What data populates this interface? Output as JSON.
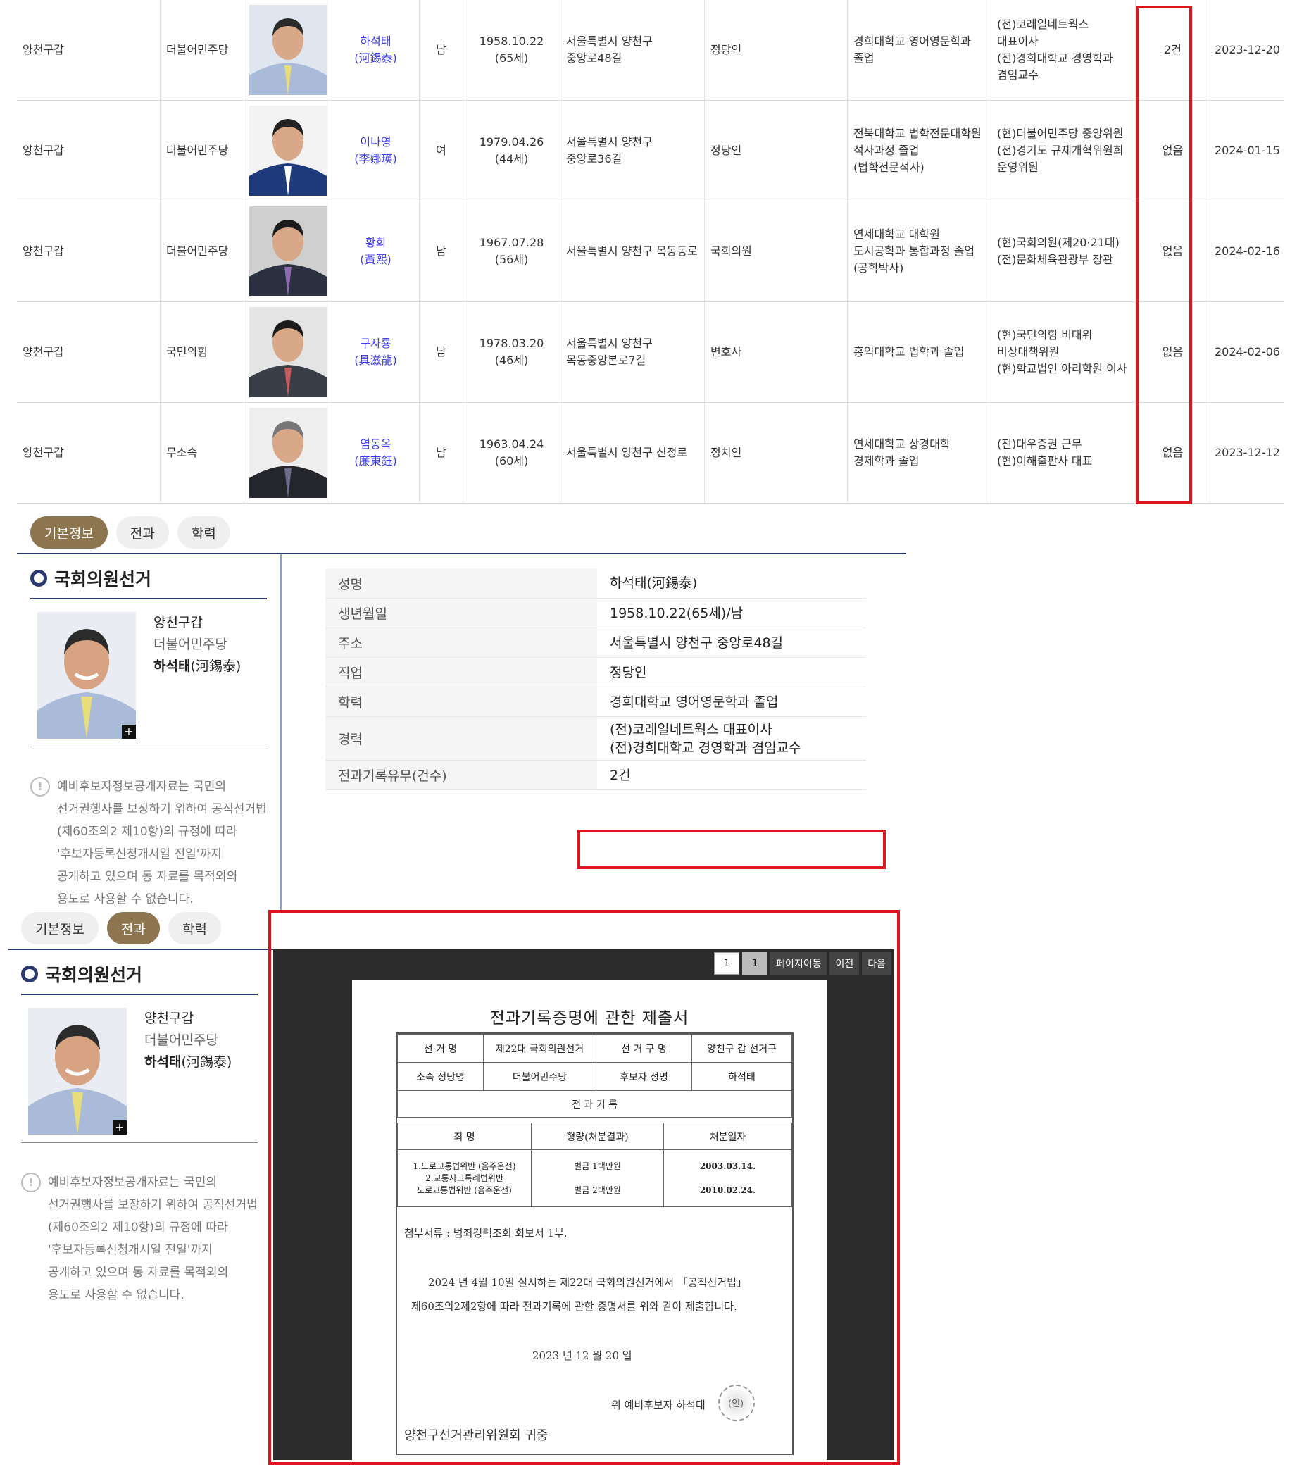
{
  "candidates": [
    {
      "district": "양천구갑",
      "party": "더불어민주당",
      "name": "하석태",
      "hanja": "(河錫泰)",
      "gender": "남",
      "birth": "1958.10.22",
      "age": "(65세)",
      "address": "서울특별시 양천구\n중앙로48길",
      "job": "정당인",
      "education": "경희대학교 영어영문학과\n졸업",
      "career": "(전)코레일네트웍스\n대표이사\n(전)경희대학교 경영학과\n겸임교수",
      "criminal": "2건",
      "date": "2023-12-20"
    },
    {
      "district": "양천구갑",
      "party": "더불어민주당",
      "name": "이나영",
      "hanja": "(李娜瑛)",
      "gender": "여",
      "birth": "1979.04.26",
      "age": "(44세)",
      "address": "서울특별시 양천구\n중앙로36길",
      "job": "정당인",
      "education": "전북대학교 법학전문대학원\n석사과정 졸업\n(법학전문석사)",
      "career": "(현)더불어민주당 중앙위원\n(전)경기도 규제개혁위원회\n운영위원",
      "criminal": "없음",
      "date": "2024-01-15"
    },
    {
      "district": "양천구갑",
      "party": "더불어민주당",
      "name": "황희",
      "hanja": "(黃熙)",
      "gender": "남",
      "birth": "1967.07.28",
      "age": "(56세)",
      "address": "서울특별시 양천구 목동동로",
      "job": "국회의원",
      "education": "연세대학교 대학원\n도시공학과 통합과정 졸업\n(공학박사)",
      "career": "(현)국회의원(제20·21대)\n(전)문화체육관광부 장관",
      "criminal": "없음",
      "date": "2024-02-16"
    },
    {
      "district": "양천구갑",
      "party": "국민의힘",
      "name": "구자룡",
      "hanja": "(具滋龍)",
      "gender": "남",
      "birth": "1978.03.20",
      "age": "(46세)",
      "address": "서울특별시 양천구\n목동중앙본로7길",
      "job": "변호사",
      "education": "홍익대학교 법학과 졸업",
      "career": "(현)국민의힘 비대위\n비상대책위원\n(현)학교법인 아리학원 이사",
      "criminal": "없음",
      "date": "2024-02-06"
    },
    {
      "district": "양천구갑",
      "party": "무소속",
      "name": "염동옥",
      "hanja": "(廉東鈺)",
      "gender": "남",
      "birth": "1963.04.24",
      "age": "(60세)",
      "address": "서울특별시 양천구 신정로",
      "job": "정치인",
      "education": "연세대학교 상경대학\n경제학과 졸업",
      "career": "(전)대우증권 근무\n(현)이해출판사 대표",
      "criminal": "없음",
      "date": "2023-12-12"
    }
  ],
  "tabs": {
    "basic": "기본정보",
    "criminal": "전과",
    "education": "학력"
  },
  "sidebar": {
    "title": "국회의원선거",
    "district": "양천구갑",
    "party": "더불어민주당",
    "name_bold": "하석태",
    "name_hanja": "(河錫泰)",
    "plus": "+",
    "notice": "예비후보자정보공개자료는 국민의\n선거권행사를 보장하기 위하여 공직선거법\n(제60조의2 제10항)의 규정에 따라\n'후보자등록신청개시일 전일'까지\n공개하고 있으며 동 자료를 목적외의\n용도로 사용할 수 없습니다.",
    "warn": "!"
  },
  "info": [
    {
      "k": "성명",
      "v": "하석태(河錫泰)"
    },
    {
      "k": "생년월일",
      "v": "1958.10.22(65세)/남"
    },
    {
      "k": "주소",
      "v": "서울특별시 양천구 중앙로48길"
    },
    {
      "k": "직업",
      "v": "정당인"
    },
    {
      "k": "학력",
      "v": "경희대학교 영어영문학과 졸업"
    },
    {
      "k": "경력",
      "v": "(전)코레일네트웍스 대표이사\n(전)경희대학교 경영학과 겸임교수"
    },
    {
      "k": "전과기록유무(건수)",
      "v": "2건"
    }
  ],
  "viewer": {
    "page1": "1",
    "page2": "1",
    "goto": "페이지이동",
    "prev": "이전",
    "next": "다음"
  },
  "doc": {
    "title": "전과기록증명에 관한 제출서",
    "h_election": "선  거  명",
    "v_election": "제22대 국회의원선거",
    "h_district": "선 거 구 명",
    "v_district": "양천구 갑  선거구",
    "h_party": "소속 정당명",
    "v_party": "더불어민주당",
    "h_name": "후보자 성명",
    "v_name": "하석태",
    "h_record": "전   과   기   록",
    "h_crime": "죄   명",
    "h_penalty": "형량(처분결과)",
    "h_date": "처분일자",
    "crime1": "1.도로교통법위반 (음주운전)",
    "crime2": "2.교통사고특례법위반",
    "crime3": "도로교통법위반 (음주운전)",
    "penalty1": "벌금 1백만원",
    "penalty2": "벌금 2백만원",
    "date1": "2003.03.14.",
    "date2": "2010.02.24.",
    "attach": "첨부서류 : 범죄경력조회 회보서 1부.",
    "body1": "2024 년   4월  10일  실시하는  제22대  국회의원선거에서 「공직선거법」",
    "body2": "제60조의2제2항에 따라 전과기록에 관한 증명서를 위와 같이 제출합니다.",
    "sign_date": "2023 년       12  월    20  일",
    "signer": "위  예비후보자  하석태",
    "seal": "(인)",
    "recipient": "양천구선거관리위원회  귀중"
  }
}
